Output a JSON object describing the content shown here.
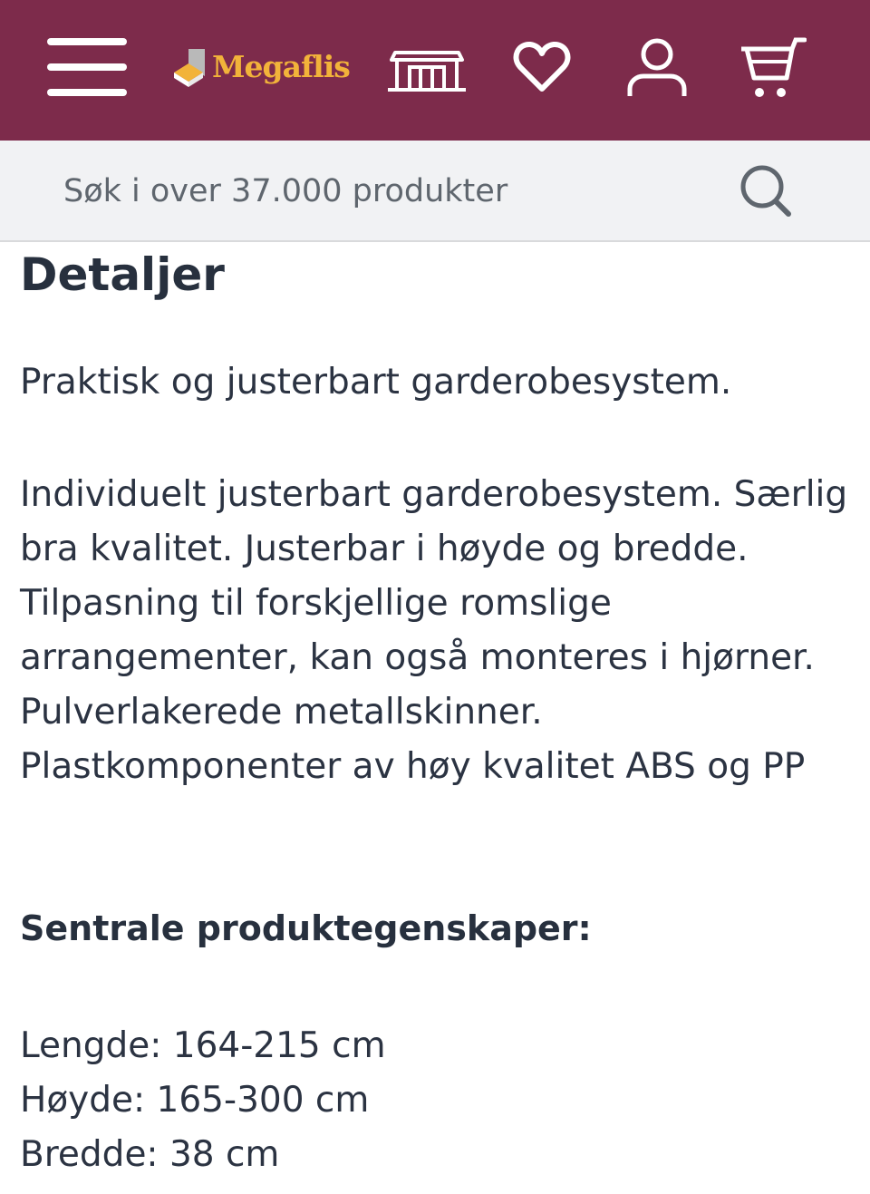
{
  "header": {
    "background_color": "#7d2b4b",
    "logo_text": "Megaflis",
    "logo_color": "#f2b33a",
    "icons": [
      "menu-icon",
      "store-icon",
      "heart-icon",
      "user-icon",
      "cart-icon"
    ]
  },
  "search": {
    "placeholder": "Søk i over 37.000 produkter",
    "value": ""
  },
  "details": {
    "title": "Detaljer",
    "intro": "Praktisk og justerbart garderobesystem.",
    "description": "Individuelt justerbart garderobesystem. Særlig bra kvalitet. Justerbar i høyde og bredde. Tilpasning til forskjellige romslige arrangementer, kan også monteres i hjørner. Pulverlakerede metallskinner. Plastkomponenter av høy kvalitet ABS og PP",
    "features_heading": "Sentrale produktegenskaper:",
    "specs": [
      "Lengde: 164-215 cm",
      "Høyde: 165-300 cm",
      "Bredde: 38 cm"
    ]
  }
}
